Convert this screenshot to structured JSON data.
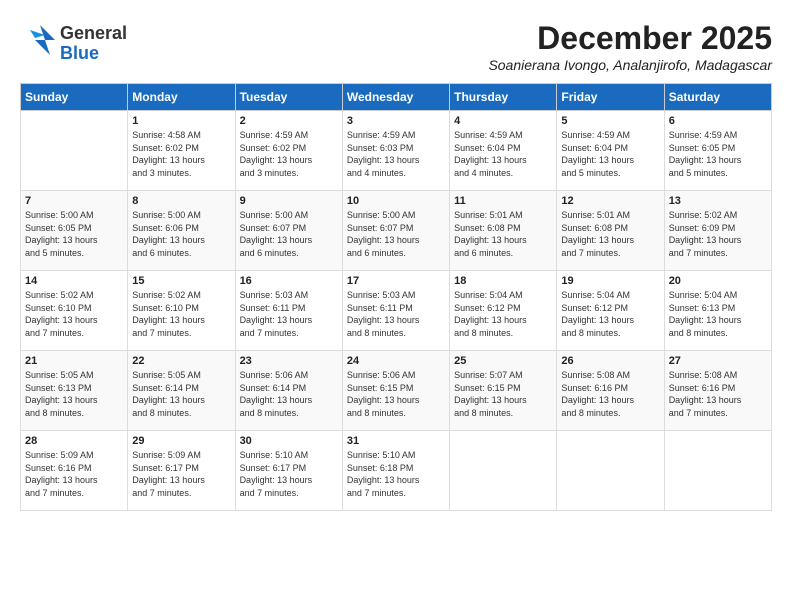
{
  "logo": {
    "general": "General",
    "blue": "Blue"
  },
  "title": {
    "month": "December 2025",
    "location": "Soanierana Ivongo, Analanjirofo, Madagascar"
  },
  "headers": [
    "Sunday",
    "Monday",
    "Tuesday",
    "Wednesday",
    "Thursday",
    "Friday",
    "Saturday"
  ],
  "weeks": [
    [
      {
        "day": "",
        "info": ""
      },
      {
        "day": "1",
        "info": "Sunrise: 4:58 AM\nSunset: 6:02 PM\nDaylight: 13 hours\nand 3 minutes."
      },
      {
        "day": "2",
        "info": "Sunrise: 4:59 AM\nSunset: 6:02 PM\nDaylight: 13 hours\nand 3 minutes."
      },
      {
        "day": "3",
        "info": "Sunrise: 4:59 AM\nSunset: 6:03 PM\nDaylight: 13 hours\nand 4 minutes."
      },
      {
        "day": "4",
        "info": "Sunrise: 4:59 AM\nSunset: 6:04 PM\nDaylight: 13 hours\nand 4 minutes."
      },
      {
        "day": "5",
        "info": "Sunrise: 4:59 AM\nSunset: 6:04 PM\nDaylight: 13 hours\nand 5 minutes."
      },
      {
        "day": "6",
        "info": "Sunrise: 4:59 AM\nSunset: 6:05 PM\nDaylight: 13 hours\nand 5 minutes."
      }
    ],
    [
      {
        "day": "7",
        "info": "Sunrise: 5:00 AM\nSunset: 6:05 PM\nDaylight: 13 hours\nand 5 minutes."
      },
      {
        "day": "8",
        "info": "Sunrise: 5:00 AM\nSunset: 6:06 PM\nDaylight: 13 hours\nand 6 minutes."
      },
      {
        "day": "9",
        "info": "Sunrise: 5:00 AM\nSunset: 6:07 PM\nDaylight: 13 hours\nand 6 minutes."
      },
      {
        "day": "10",
        "info": "Sunrise: 5:00 AM\nSunset: 6:07 PM\nDaylight: 13 hours\nand 6 minutes."
      },
      {
        "day": "11",
        "info": "Sunrise: 5:01 AM\nSunset: 6:08 PM\nDaylight: 13 hours\nand 6 minutes."
      },
      {
        "day": "12",
        "info": "Sunrise: 5:01 AM\nSunset: 6:08 PM\nDaylight: 13 hours\nand 7 minutes."
      },
      {
        "day": "13",
        "info": "Sunrise: 5:02 AM\nSunset: 6:09 PM\nDaylight: 13 hours\nand 7 minutes."
      }
    ],
    [
      {
        "day": "14",
        "info": "Sunrise: 5:02 AM\nSunset: 6:10 PM\nDaylight: 13 hours\nand 7 minutes."
      },
      {
        "day": "15",
        "info": "Sunrise: 5:02 AM\nSunset: 6:10 PM\nDaylight: 13 hours\nand 7 minutes."
      },
      {
        "day": "16",
        "info": "Sunrise: 5:03 AM\nSunset: 6:11 PM\nDaylight: 13 hours\nand 7 minutes."
      },
      {
        "day": "17",
        "info": "Sunrise: 5:03 AM\nSunset: 6:11 PM\nDaylight: 13 hours\nand 8 minutes."
      },
      {
        "day": "18",
        "info": "Sunrise: 5:04 AM\nSunset: 6:12 PM\nDaylight: 13 hours\nand 8 minutes."
      },
      {
        "day": "19",
        "info": "Sunrise: 5:04 AM\nSunset: 6:12 PM\nDaylight: 13 hours\nand 8 minutes."
      },
      {
        "day": "20",
        "info": "Sunrise: 5:04 AM\nSunset: 6:13 PM\nDaylight: 13 hours\nand 8 minutes."
      }
    ],
    [
      {
        "day": "21",
        "info": "Sunrise: 5:05 AM\nSunset: 6:13 PM\nDaylight: 13 hours\nand 8 minutes."
      },
      {
        "day": "22",
        "info": "Sunrise: 5:05 AM\nSunset: 6:14 PM\nDaylight: 13 hours\nand 8 minutes."
      },
      {
        "day": "23",
        "info": "Sunrise: 5:06 AM\nSunset: 6:14 PM\nDaylight: 13 hours\nand 8 minutes."
      },
      {
        "day": "24",
        "info": "Sunrise: 5:06 AM\nSunset: 6:15 PM\nDaylight: 13 hours\nand 8 minutes."
      },
      {
        "day": "25",
        "info": "Sunrise: 5:07 AM\nSunset: 6:15 PM\nDaylight: 13 hours\nand 8 minutes."
      },
      {
        "day": "26",
        "info": "Sunrise: 5:08 AM\nSunset: 6:16 PM\nDaylight: 13 hours\nand 8 minutes."
      },
      {
        "day": "27",
        "info": "Sunrise: 5:08 AM\nSunset: 6:16 PM\nDaylight: 13 hours\nand 7 minutes."
      }
    ],
    [
      {
        "day": "28",
        "info": "Sunrise: 5:09 AM\nSunset: 6:16 PM\nDaylight: 13 hours\nand 7 minutes."
      },
      {
        "day": "29",
        "info": "Sunrise: 5:09 AM\nSunset: 6:17 PM\nDaylight: 13 hours\nand 7 minutes."
      },
      {
        "day": "30",
        "info": "Sunrise: 5:10 AM\nSunset: 6:17 PM\nDaylight: 13 hours\nand 7 minutes."
      },
      {
        "day": "31",
        "info": "Sunrise: 5:10 AM\nSunset: 6:18 PM\nDaylight: 13 hours\nand 7 minutes."
      },
      {
        "day": "",
        "info": ""
      },
      {
        "day": "",
        "info": ""
      },
      {
        "day": "",
        "info": ""
      }
    ]
  ]
}
